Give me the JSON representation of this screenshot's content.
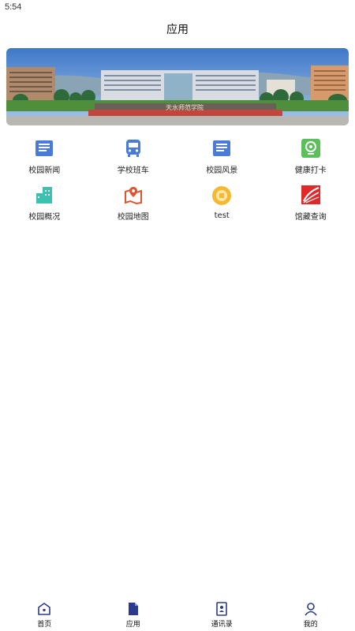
{
  "status_bar": {
    "time": "5:54"
  },
  "header": {
    "title": "应用"
  },
  "banner": {
    "sign_text": "天水师范学院"
  },
  "apps": [
    {
      "label": "校园新闻",
      "icon": "news-icon"
    },
    {
      "label": "学校班车",
      "icon": "bus-icon"
    },
    {
      "label": "校园风景",
      "icon": "scenery-icon"
    },
    {
      "label": "健康打卡",
      "icon": "health-checkin-icon"
    },
    {
      "label": "校园概况",
      "icon": "building-icon"
    },
    {
      "label": "校园地图",
      "icon": "map-icon"
    },
    {
      "label": "test",
      "icon": "test-icon"
    },
    {
      "label": "馆藏查询",
      "icon": "library-icon"
    }
  ],
  "tabbar": {
    "items": [
      {
        "label": "首页",
        "icon": "home-icon"
      },
      {
        "label": "应用",
        "icon": "apps-doc-icon",
        "active": true
      },
      {
        "label": "通讯录",
        "icon": "contacts-icon"
      },
      {
        "label": "我的",
        "icon": "profile-icon"
      }
    ]
  },
  "colors": {
    "primary": "#2b3a8c",
    "news_blue": "#4a7bd6",
    "health_green": "#5bbf5a",
    "teal": "#3cc1b0",
    "map_red": "#e0552f",
    "test_yellow": "#f5b833",
    "library_red": "#e02a2a"
  }
}
